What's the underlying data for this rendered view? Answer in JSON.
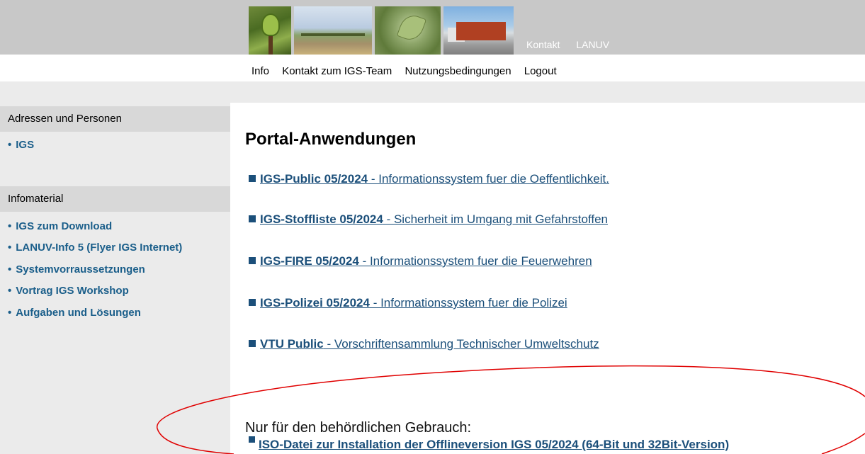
{
  "top_links": [
    "Kontakt",
    "LANUV"
  ],
  "main_nav": [
    "Info",
    "Kontakt zum IGS-Team",
    "Nutzungsbedingungen",
    "Logout"
  ],
  "sidebar": {
    "section1": {
      "title": "Adressen und Personen",
      "items": [
        "IGS"
      ]
    },
    "section2": {
      "title": "Infomaterial",
      "items": [
        "IGS zum Download",
        "LANUV-Info 5 (Flyer IGS Internet)",
        "Systemvorraussetzungen",
        "Vortrag IGS Workshop",
        "Aufgaben und Lösungen"
      ]
    }
  },
  "main": {
    "title": "Portal-Anwendungen",
    "apps": [
      {
        "name": "IGS-Public 05/2024",
        "desc": " - Informationssystem fuer die Oeffentlichkeit."
      },
      {
        "name": "IGS-Stoffliste 05/2024",
        "desc": " - Sicherheit im Umgang mit Gefahrstoffen"
      },
      {
        "name": "IGS-FIRE 05/2024",
        "desc": " - Informationssystem fuer die Feuerwehren"
      },
      {
        "name": "IGS-Polizei 05/2024",
        "desc": " - Informationssystem fuer die Polizei"
      },
      {
        "name": "VTU Public",
        "desc": " - Vorschriftensammlung Technischer Umweltschutz"
      }
    ],
    "restricted_note": "Nur für den behördlichen Gebrauch:",
    "iso_link": "ISO-Datei zur Installation der Offlineversion IGS 05/2024 (64-Bit und 32Bit-Version)"
  },
  "colors": {
    "link": "#1b4f7a",
    "sidebar_link": "#1a5e8a",
    "annotation": "#e00000"
  }
}
